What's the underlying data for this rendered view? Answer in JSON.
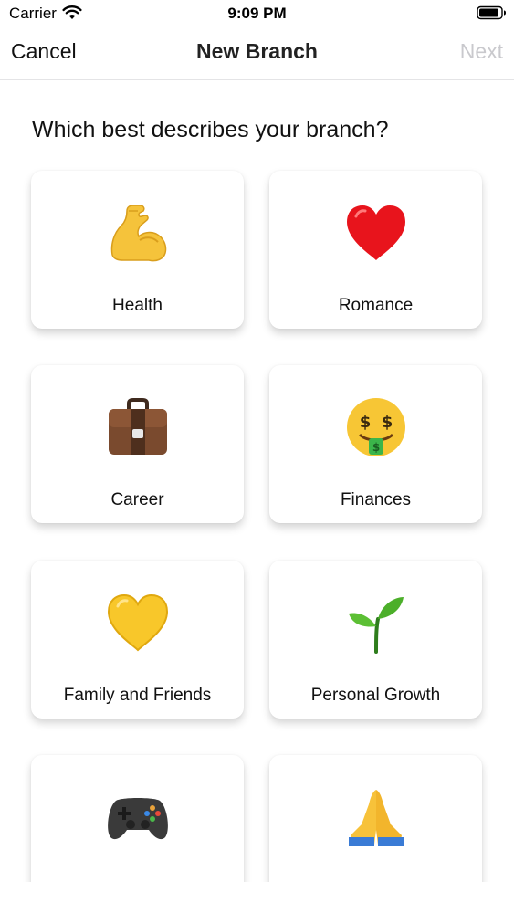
{
  "status_bar": {
    "carrier": "Carrier",
    "time": "9:09 PM",
    "wifi_icon": "wifi-icon",
    "battery_icon": "battery-icon"
  },
  "nav": {
    "cancel_label": "Cancel",
    "title": "New Branch",
    "next_label": "Next",
    "next_color": "#c9c9cd"
  },
  "question": "Which best describes your branch?",
  "categories": [
    {
      "label": "Health",
      "icon": "flexed-biceps-icon"
    },
    {
      "label": "Romance",
      "icon": "red-heart-icon"
    },
    {
      "label": "Career",
      "icon": "briefcase-icon"
    },
    {
      "label": "Finances",
      "icon": "money-mouth-face-icon"
    },
    {
      "label": "Family and Friends",
      "icon": "yellow-heart-icon"
    },
    {
      "label": "Personal Growth",
      "icon": "seedling-icon"
    },
    {
      "label": "",
      "icon": "video-game-controller-icon"
    },
    {
      "label": "",
      "icon": "folded-hands-icon"
    }
  ]
}
